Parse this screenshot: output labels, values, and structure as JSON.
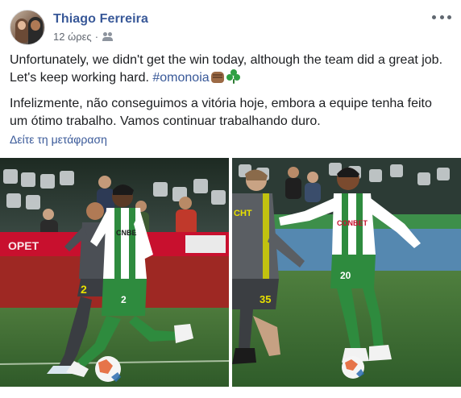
{
  "post": {
    "author": "Thiago Ferreira",
    "time": "12 ώρες",
    "separator": "·",
    "audience_icon": "friends-icon",
    "more_icon": "more-options-icon",
    "text_en_before": "Unfortunately, we didn't get the win today, although the team did a great job. Let's keep working hard. ",
    "hashtag": "#omonoia",
    "text_pt": "Infelizmente, não conseguimos a vitória hoje, embora a equipe tenha feito um ótimo trabalho. Vamos continuar trabalhando duro.",
    "translate_label": "Δείτε τη μετάφραση",
    "emojis": [
      "fist-emoji",
      "shamrock-emoji"
    ]
  },
  "photos": [
    {
      "name": "photo-left",
      "jersey_text": "CNBET",
      "shorts_number": "2",
      "opponent_number": "2"
    },
    {
      "name": "photo-right",
      "jersey_text": "CONBET",
      "shorts_number": "20",
      "opponent_number": "35",
      "opponent_shirt_text": "CHT"
    }
  ],
  "colors": {
    "link": "#385898",
    "text": "#1c1e21",
    "meta": "#616770",
    "omonoia_green": "#2e8b3e",
    "pitch_green": "#3f6b35"
  }
}
